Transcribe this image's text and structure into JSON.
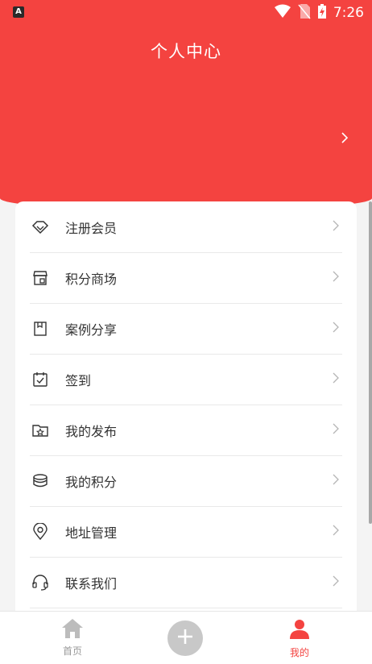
{
  "status_bar": {
    "time": "7:26",
    "app_badge": "A"
  },
  "header": {
    "title": "个人中心"
  },
  "menu": [
    {
      "label": "注册会员",
      "icon": "diamond-icon"
    },
    {
      "label": "积分商场",
      "icon": "store-icon"
    },
    {
      "label": "案例分享",
      "icon": "bookmark-icon"
    },
    {
      "label": "签到",
      "icon": "calendar-check-icon"
    },
    {
      "label": "我的发布",
      "icon": "folder-star-icon"
    },
    {
      "label": "我的积分",
      "icon": "coins-icon"
    },
    {
      "label": "地址管理",
      "icon": "location-pin-icon"
    },
    {
      "label": "联系我们",
      "icon": "headset-icon"
    }
  ],
  "tab_bar": {
    "home_label": "首页",
    "mine_label": "我的",
    "active_color": "#f44340",
    "inactive_color": "#999999"
  }
}
